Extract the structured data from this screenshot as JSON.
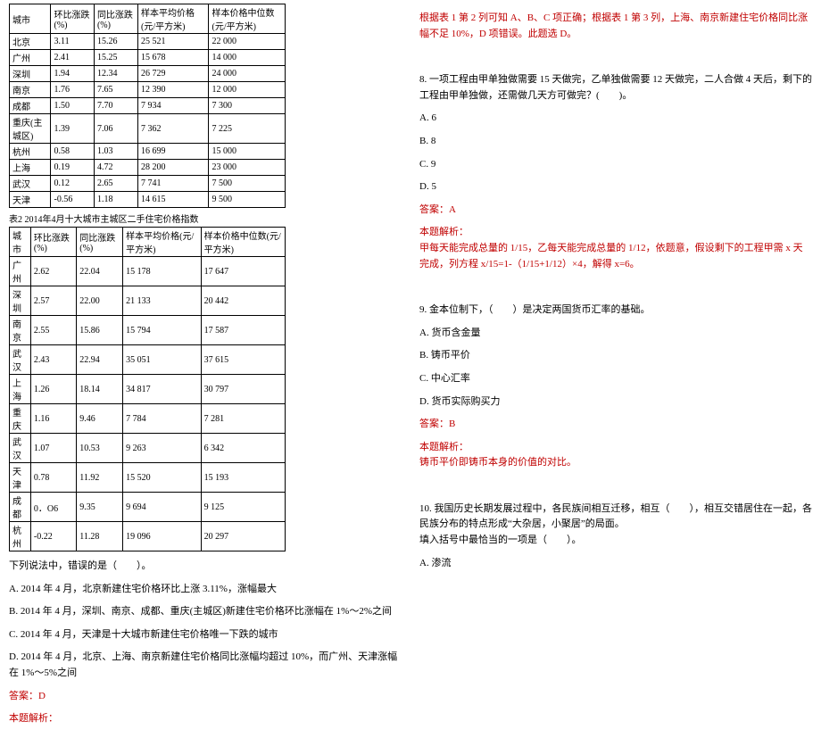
{
  "table1": {
    "headers": [
      "城市",
      "环比涨跌(%)",
      "同比涨跌(%)",
      "样本平均价格(元/平方米)",
      "样本价格中位数(元/平方米)"
    ],
    "rows": [
      [
        "北京",
        "3.11",
        "15.26",
        "25 521",
        "22 000"
      ],
      [
        "广州",
        "2.41",
        "15.25",
        "15 678",
        "14 000"
      ],
      [
        "深圳",
        "1.94",
        "12.34",
        "26 729",
        "24 000"
      ],
      [
        "南京",
        "1.76",
        "7.65",
        "12 390",
        "12 000"
      ],
      [
        "成都",
        "1.50",
        "7.70",
        "7 934",
        "7 300"
      ],
      [
        "重庆(主城区)",
        "1.39",
        "7.06",
        "7 362",
        "7 225"
      ],
      [
        "杭州",
        "0.58",
        "1.03",
        "16 699",
        "15 000"
      ],
      [
        "上海",
        "0.19",
        "4.72",
        "28 200",
        "23 000"
      ],
      [
        "武汉",
        "0.12",
        "2.65",
        "7 741",
        "7 500"
      ],
      [
        "天津",
        "-0.56",
        "1.18",
        "14 615",
        "9 500"
      ]
    ]
  },
  "table2_title": "表2 2014年4月十大城市主城区二手住宅价格指数",
  "table2": {
    "headers": [
      "城市",
      "环比涨跌(%)",
      "同比涨跌(%)",
      "样本平均价格(元/平方米)",
      "样本价格中位数(元/平方米)"
    ],
    "rows": [
      [
        "广州",
        "2.62",
        "22.04",
        "15 178",
        "17 647"
      ],
      [
        "深圳",
        "2.57",
        "22.00",
        "21 133",
        "20 442"
      ],
      [
        "南京",
        "2.55",
        "15.86",
        "15 794",
        "17 587"
      ],
      [
        "武汉",
        "2.43",
        "22.94",
        "35 051",
        "37 615"
      ],
      [
        "上海",
        "1.26",
        "18.14",
        "34 817",
        "30 797"
      ],
      [
        "重庆",
        "1.16",
        "9.46",
        "7 784",
        "7 281"
      ],
      [
        "武汉",
        "1.07",
        "10.53",
        "9 263",
        "6 342"
      ],
      [
        "天津",
        "0.78",
        "11.92",
        "15 520",
        "15 193"
      ],
      [
        "成都",
        "0．O6",
        "9.35",
        "9 694",
        "9 125"
      ],
      [
        "杭州",
        "-0.22",
        "11.28",
        "19 096",
        "20 297"
      ]
    ]
  },
  "q7": {
    "stem": "下列说法中，错误的是（　　）。",
    "A": "A. 2014 年 4 月，北京新建住宅价格环比上涨 3.11%，涨幅最大",
    "B": "B. 2014 年 4 月，深圳、南京、成都、重庆(主城区)新建住宅价格环比涨幅在 1%～2%之间",
    "C": "C. 2014 年 4 月，天津是十大城市新建住宅价格唯一下跌的城市",
    "D": "D. 2014 年 4 月，北京、上海、南京新建住宅价格同比涨幅均超过 10%，而广州、天津涨幅在 1%～5%之间",
    "answer": "答案：D",
    "parse_label": "本题解析：",
    "parse": "根据表 1 第 2 列可知 A、B、C 项正确；根据表 1 第 3 列，上海、南京新建住宅价格同比涨幅不足 10%，D 项错误。此题选 D。"
  },
  "q8": {
    "stem": "8. 一项工程由甲单独做需要 15 天做完，乙单独做需要 12 天做完，二人合做 4 天后，剩下的工程由甲单独做，还需做几天方可做完？(　　)。",
    "A": "A. 6",
    "B": "B. 8",
    "C": "C. 9",
    "D": "D. 5",
    "answer": "答案：A",
    "parse_label": "本题解析：",
    "parse": "甲每天能完成总量的 1/15，乙每天能完成总量的 1/12，依题意，假设剩下的工程甲需 x 天完成，列方程 x/15=1-（1/15+1/12）×4，解得 x=6。"
  },
  "q9": {
    "stem": "9. 金本位制下，（　　）是决定两国货币汇率的基础。",
    "A": "A. 货币含金量",
    "B": "B. 铸币平价",
    "C": "C. 中心汇率",
    "D": "D. 货币实际购买力",
    "answer": "答案：B",
    "parse_label": "本题解析：",
    "parse": "铸币平价即铸币本身的价值的对比。"
  },
  "q10": {
    "stem1": "10. 我国历史长期发展过程中，各民族间相互迁移，相互（　　），相互交错居住在一起，各民族分布的特点形成“大杂居，小聚居”的局面。",
    "stem2": "填入括号中最恰当的一项是（　　）。",
    "A": "A. 渗流"
  }
}
